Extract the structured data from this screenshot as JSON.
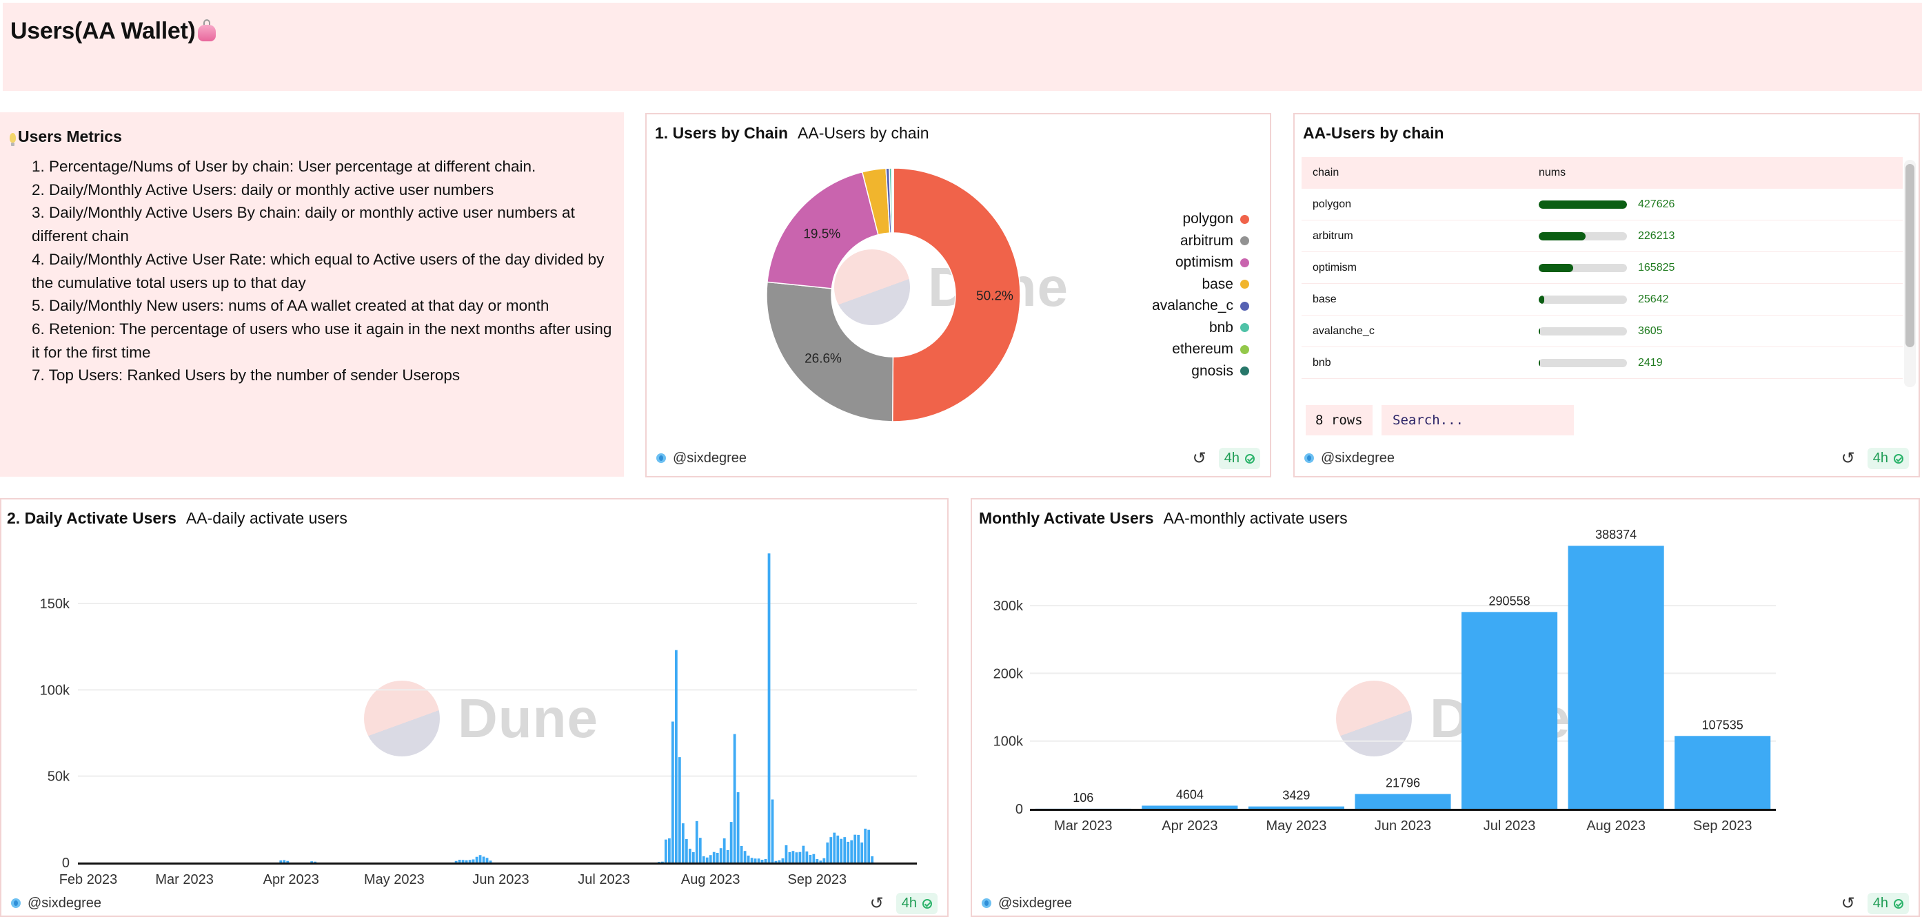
{
  "header": {
    "title": "Users(AA Wallet)",
    "title_icon": "purse-icon",
    "background": "#ffebeb"
  },
  "metrics": {
    "title": "Users Metrics",
    "title_icon": "light-bulb-icon",
    "items": [
      "1. Percentage/Nums of User by chain: User percentage at different chain.",
      "2. Daily/Monthly Active Users: daily or monthly active user numbers",
      "3. Daily/Monthly Active Users By chain: daily or monthly active user numbers at different chain",
      "4. Daily/Monthly Active User Rate: which equal to Active users of the day divided by the cumulative total users up to that day",
      "5. Daily/Monthly New users: nums of AA wallet created at that day or month",
      "6. Retenion: The percentage of users who use it again in the next months after using it for the first time",
      "7. Top Users: Ranked Users by the number of sender Userops"
    ]
  },
  "common": {
    "author": "@sixdegree",
    "refresh_icon": "refresh-icon",
    "age_badge": "4h",
    "watermark": "Dune"
  },
  "pie_card": {
    "title": "1. Users by Chain",
    "subtitle": "AA-Users by chain"
  },
  "table_card": {
    "title": "AA-Users by chain",
    "columns": [
      "chain",
      "nums"
    ],
    "rows": [
      {
        "chain": "polygon",
        "nums": "427626",
        "fraction": 1.0
      },
      {
        "chain": "arbitrum",
        "nums": "226213",
        "fraction": 0.529
      },
      {
        "chain": "optimism",
        "nums": "165825",
        "fraction": 0.388
      },
      {
        "chain": "base",
        "nums": "25642",
        "fraction": 0.06
      },
      {
        "chain": "avalanche_c",
        "nums": "3605",
        "fraction": 0.0084
      },
      {
        "chain": "bnb",
        "nums": "2419",
        "fraction": 0.0057
      }
    ],
    "rows_count": "8 rows",
    "search_placeholder": "Search...",
    "bar_color": "#0b5e13",
    "num_color": "#1e7a1e"
  },
  "daily_card": {
    "title": "2. Daily Activate Users",
    "subtitle": "AA-daily activate users"
  },
  "monthly_card": {
    "title": "Monthly Activate Users",
    "subtitle": "AA-monthly activate users"
  },
  "chart_data": [
    {
      "id": "users-by-chain",
      "type": "pie",
      "donut": true,
      "labels": [
        "polygon",
        "arbitrum",
        "optimism",
        "base",
        "avalanche_c",
        "bnb",
        "ethereum",
        "gnosis"
      ],
      "values": [
        427626,
        226213,
        165825,
        25642,
        3605,
        2419,
        null,
        null
      ],
      "colors": [
        "#f0634a",
        "#929292",
        "#c964ae",
        "#f1b52d",
        "#5662b3",
        "#4fc2a7",
        "#93c84a",
        "#27776a"
      ],
      "data_labels": [
        {
          "label": "polygon",
          "text": "50.2%"
        },
        {
          "label": "arbitrum",
          "text": "26.6%"
        },
        {
          "label": "optimism",
          "text": "19.5%"
        }
      ],
      "legend": "right"
    },
    {
      "id": "daily-active-users",
      "type": "bar",
      "title": "AA-daily activate users",
      "xlabel": "",
      "ylabel": "",
      "x_range": [
        "2023-01-29",
        "2023-09-30"
      ],
      "x_ticks": [
        {
          "date": "2023-02-01",
          "label": "Feb 2023"
        },
        {
          "date": "2023-03-01",
          "label": "Mar 2023"
        },
        {
          "date": "2023-04-01",
          "label": "Apr 2023"
        },
        {
          "date": "2023-05-01",
          "label": "May 2023"
        },
        {
          "date": "2023-06-01",
          "label": "Jun 2023"
        },
        {
          "date": "2023-07-01",
          "label": "Jul 2023"
        },
        {
          "date": "2023-08-01",
          "label": "Aug 2023"
        },
        {
          "date": "2023-09-01",
          "label": "Sep 2023"
        }
      ],
      "y_ticks": [
        0,
        50000,
        100000,
        150000
      ],
      "y_tick_labels": [
        "0",
        "50k",
        "100k",
        "150k"
      ],
      "ylim": [
        0,
        185000
      ],
      "grid": true,
      "color": "#3daaf5",
      "points": [
        {
          "x": "2023-03-29",
          "y": 1200
        },
        {
          "x": "2023-03-30",
          "y": 1400
        },
        {
          "x": "2023-03-31",
          "y": 900
        },
        {
          "x": "2023-04-07",
          "y": 700
        },
        {
          "x": "2023-04-08",
          "y": 500
        },
        {
          "x": "2023-05-19",
          "y": 900
        },
        {
          "x": "2023-05-20",
          "y": 1600
        },
        {
          "x": "2023-05-21",
          "y": 1500
        },
        {
          "x": "2023-05-22",
          "y": 1300
        },
        {
          "x": "2023-05-23",
          "y": 1500
        },
        {
          "x": "2023-05-24",
          "y": 1800
        },
        {
          "x": "2023-05-25",
          "y": 3300
        },
        {
          "x": "2023-05-26",
          "y": 4300
        },
        {
          "x": "2023-05-27",
          "y": 3400
        },
        {
          "x": "2023-05-28",
          "y": 2700
        },
        {
          "x": "2023-05-29",
          "y": 1100
        },
        {
          "x": "2023-07-17",
          "y": 300
        },
        {
          "x": "2023-07-18",
          "y": 500
        },
        {
          "x": "2023-07-19",
          "y": 13300
        },
        {
          "x": "2023-07-20",
          "y": 14000
        },
        {
          "x": "2023-07-21",
          "y": 81600
        },
        {
          "x": "2023-07-22",
          "y": 123000
        },
        {
          "x": "2023-07-23",
          "y": 61000
        },
        {
          "x": "2023-07-24",
          "y": 22700
        },
        {
          "x": "2023-07-25",
          "y": 13600
        },
        {
          "x": "2023-07-26",
          "y": 8000
        },
        {
          "x": "2023-07-27",
          "y": 6000
        },
        {
          "x": "2023-07-28",
          "y": 24000
        },
        {
          "x": "2023-07-29",
          "y": 14300
        },
        {
          "x": "2023-07-30",
          "y": 3600
        },
        {
          "x": "2023-07-31",
          "y": 2900
        },
        {
          "x": "2023-08-01",
          "y": 4300
        },
        {
          "x": "2023-08-02",
          "y": 6100
        },
        {
          "x": "2023-08-03",
          "y": 5600
        },
        {
          "x": "2023-08-04",
          "y": 8300
        },
        {
          "x": "2023-08-05",
          "y": 14000
        },
        {
          "x": "2023-08-06",
          "y": 7200
        },
        {
          "x": "2023-08-07",
          "y": 23500
        },
        {
          "x": "2023-08-08",
          "y": 74400
        },
        {
          "x": "2023-08-09",
          "y": 40700
        },
        {
          "x": "2023-08-10",
          "y": 9600
        },
        {
          "x": "2023-08-11",
          "y": 6700
        },
        {
          "x": "2023-08-12",
          "y": 4000
        },
        {
          "x": "2023-08-13",
          "y": 2700
        },
        {
          "x": "2023-08-14",
          "y": 2300
        },
        {
          "x": "2023-08-15",
          "y": 2300
        },
        {
          "x": "2023-08-16",
          "y": 1600
        },
        {
          "x": "2023-08-17",
          "y": 2000
        },
        {
          "x": "2023-08-18",
          "y": 179000
        },
        {
          "x": "2023-08-19",
          "y": 36500
        },
        {
          "x": "2023-08-20",
          "y": 900
        },
        {
          "x": "2023-08-21",
          "y": 1300
        },
        {
          "x": "2023-08-22",
          "y": 2400
        },
        {
          "x": "2023-08-23",
          "y": 10000
        },
        {
          "x": "2023-08-24",
          "y": 6000
        },
        {
          "x": "2023-08-25",
          "y": 6700
        },
        {
          "x": "2023-08-26",
          "y": 5900
        },
        {
          "x": "2023-08-27",
          "y": 6100
        },
        {
          "x": "2023-08-28",
          "y": 9700
        },
        {
          "x": "2023-08-29",
          "y": 6400
        },
        {
          "x": "2023-08-30",
          "y": 4400
        },
        {
          "x": "2023-08-31",
          "y": 4900
        },
        {
          "x": "2023-09-01",
          "y": 2000
        },
        {
          "x": "2023-09-02",
          "y": 1100
        },
        {
          "x": "2023-09-03",
          "y": 2500
        },
        {
          "x": "2023-09-04",
          "y": 11600
        },
        {
          "x": "2023-09-05",
          "y": 14700
        },
        {
          "x": "2023-09-06",
          "y": 17300
        },
        {
          "x": "2023-09-07",
          "y": 15600
        },
        {
          "x": "2023-09-08",
          "y": 13700
        },
        {
          "x": "2023-09-09",
          "y": 14700
        },
        {
          "x": "2023-09-10",
          "y": 12000
        },
        {
          "x": "2023-09-11",
          "y": 12900
        },
        {
          "x": "2023-09-12",
          "y": 16100
        },
        {
          "x": "2023-09-13",
          "y": 16000
        },
        {
          "x": "2023-09-14",
          "y": 11600
        },
        {
          "x": "2023-09-15",
          "y": 19600
        },
        {
          "x": "2023-09-16",
          "y": 18900
        },
        {
          "x": "2023-09-17",
          "y": 3600
        }
      ]
    },
    {
      "id": "monthly-active-users",
      "type": "bar",
      "title": "AA-monthly activate users",
      "xlabel": "",
      "ylabel": "",
      "categories": [
        "Mar 2023",
        "Apr 2023",
        "May 2023",
        "Jun 2023",
        "Jul 2023",
        "Aug 2023",
        "Sep 2023"
      ],
      "values": [
        106,
        4604,
        3429,
        21796,
        290558,
        388374,
        107535
      ],
      "data_labels": [
        "106",
        "4604",
        "3429",
        "21796",
        "290558",
        "388374",
        "107535"
      ],
      "y_ticks": [
        0,
        100000,
        200000,
        300000
      ],
      "y_tick_labels": [
        "0",
        "100k",
        "200k",
        "300k"
      ],
      "ylim": [
        0,
        400000
      ],
      "grid": true,
      "color": "#3daaf5"
    }
  ]
}
